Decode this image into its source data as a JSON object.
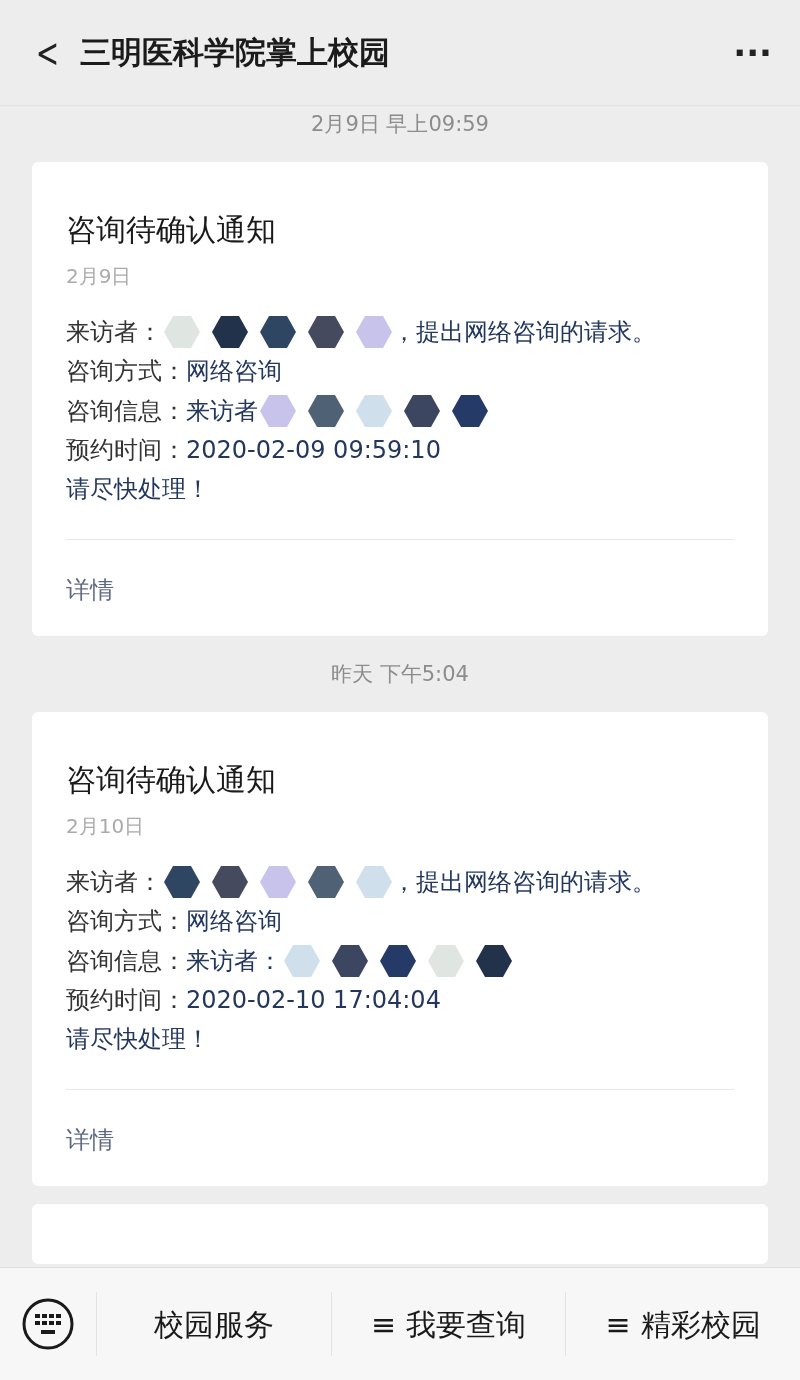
{
  "header": {
    "back": "<",
    "title": "三明医科学院掌上校园",
    "more": "···"
  },
  "messages": [
    {
      "time": "2月9日 早上09:59",
      "title": "咨询待确认通知",
      "date": "2月9日",
      "lines": [
        {
          "label": "来访者：",
          "redacted": true,
          "suffix": "，提出网络咨询的请求。"
        },
        {
          "label": "咨询方式：",
          "value": "网络咨询",
          "redacted": false
        },
        {
          "label": "咨询信息：",
          "value": "来访者",
          "redacted": true
        },
        {
          "label": "预约时间：",
          "value": "2020-02-09 09:59:10",
          "redacted": false
        }
      ],
      "note": "请尽快处理！",
      "link": "详情"
    },
    {
      "time": "昨天 下午5:04",
      "title": "咨询待确认通知",
      "date": "2月10日",
      "lines": [
        {
          "label": "来访者：",
          "redacted": true,
          "suffix": "，提出网络咨询的请求。"
        },
        {
          "label": "咨询方式：",
          "value": "网络咨询",
          "redacted": false
        },
        {
          "label": "咨询信息：",
          "value": "来访者：",
          "redacted": true
        },
        {
          "label": "预约时间：",
          "value": "2020-02-10 17:04:04",
          "redacted": false
        }
      ],
      "note": "请尽快处理！",
      "link": "详情"
    }
  ],
  "menu": [
    {
      "label": "校园服务"
    },
    {
      "label": "我要查询",
      "mark": "≡"
    },
    {
      "label": "精彩校园",
      "mark": "≡"
    }
  ]
}
